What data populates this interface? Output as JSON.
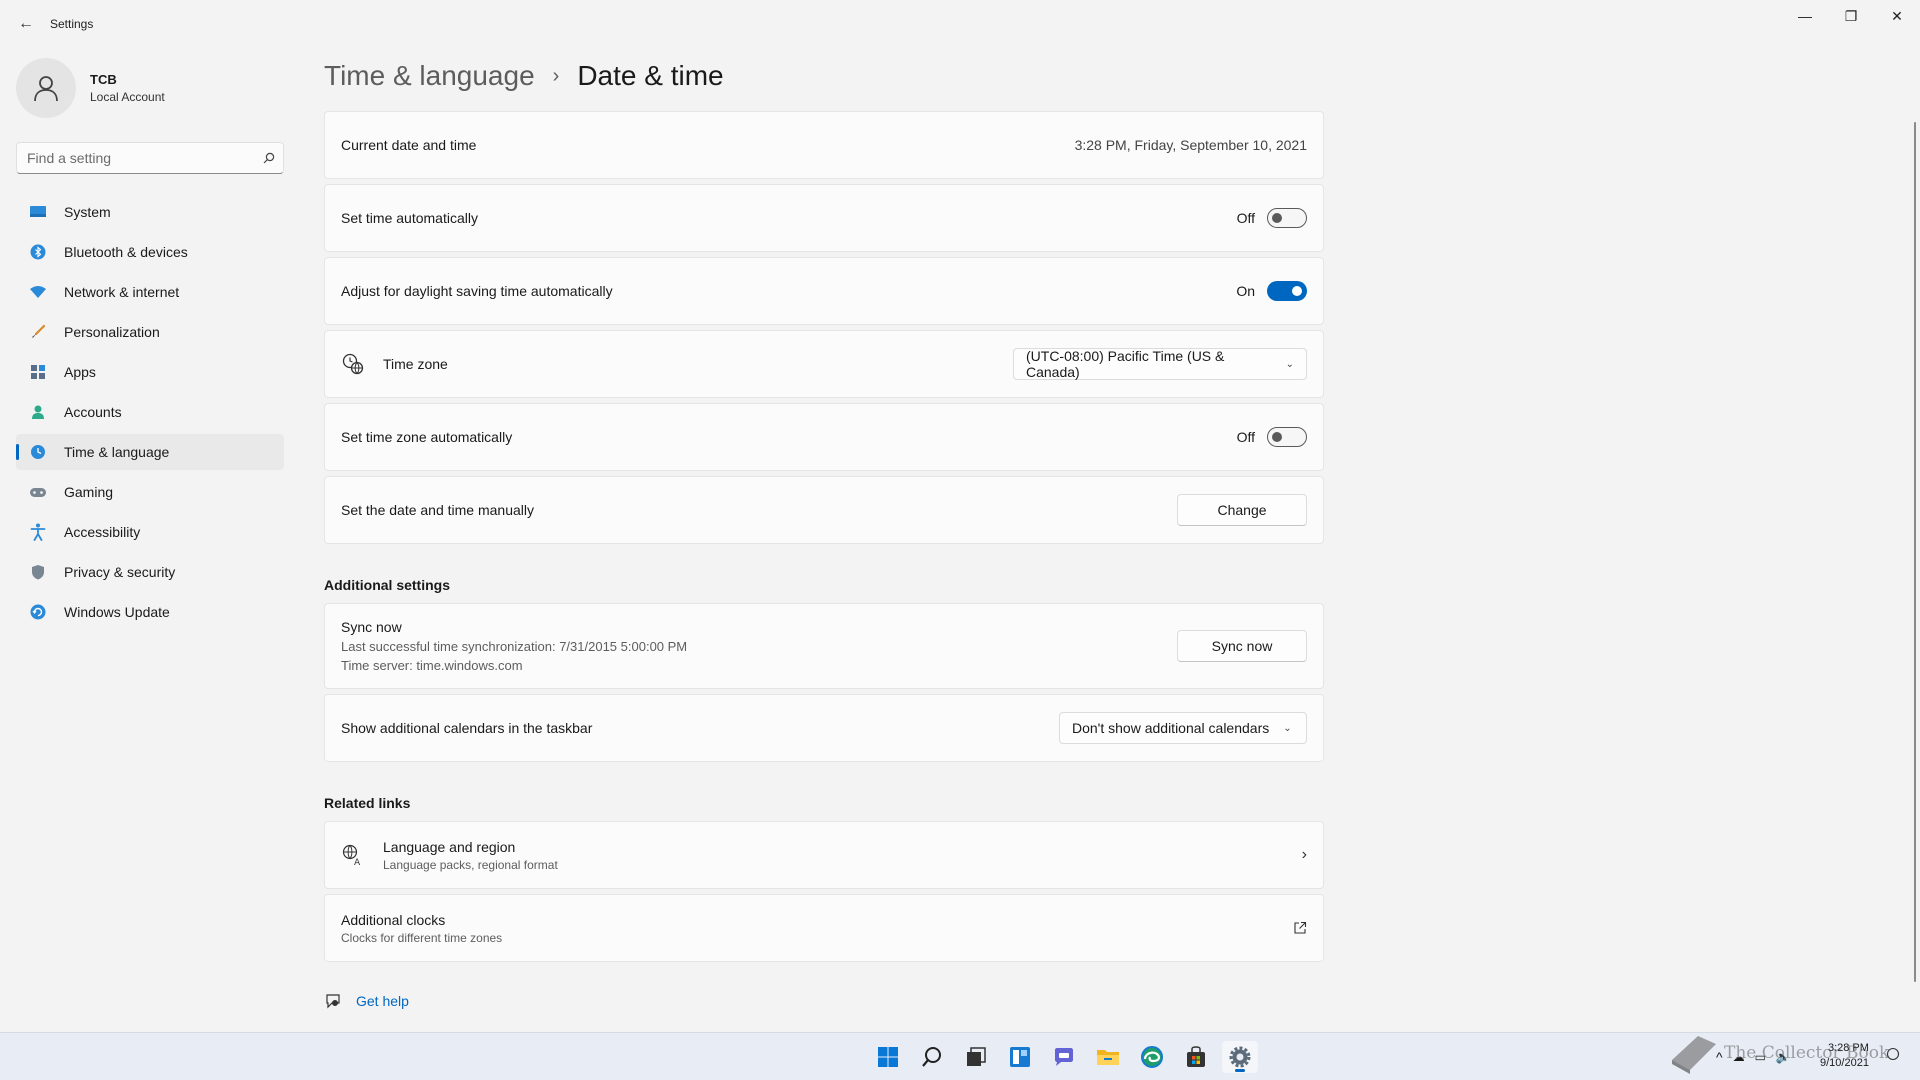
{
  "window": {
    "title": "Settings",
    "minimize_glyph": "—",
    "maximize_glyph": "❐",
    "close_glyph": "✕",
    "back_glyph": "←"
  },
  "profile": {
    "name": "TCB",
    "account_type": "Local Account"
  },
  "search": {
    "placeholder": "Find a setting"
  },
  "sidebar": {
    "items": [
      {
        "label": "System",
        "icon": "monitor-icon"
      },
      {
        "label": "Bluetooth & devices",
        "icon": "bluetooth-icon"
      },
      {
        "label": "Network & internet",
        "icon": "wifi-icon"
      },
      {
        "label": "Personalization",
        "icon": "brush-icon"
      },
      {
        "label": "Apps",
        "icon": "apps-icon"
      },
      {
        "label": "Accounts",
        "icon": "person-icon"
      },
      {
        "label": "Time & language",
        "icon": "globe-clock-icon",
        "selected": true
      },
      {
        "label": "Gaming",
        "icon": "gamepad-icon"
      },
      {
        "label": "Accessibility",
        "icon": "accessibility-icon"
      },
      {
        "label": "Privacy & security",
        "icon": "shield-icon"
      },
      {
        "label": "Windows Update",
        "icon": "update-icon"
      }
    ]
  },
  "breadcrumb": {
    "parent": "Time & language",
    "separator": "›",
    "current": "Date & time"
  },
  "settings": {
    "current_datetime": {
      "label": "Current date and time",
      "value": "3:28 PM, Friday, September 10, 2021"
    },
    "set_time_auto": {
      "label": "Set time automatically",
      "state": "Off"
    },
    "daylight_saving": {
      "label": "Adjust for daylight saving time automatically",
      "state": "On"
    },
    "time_zone": {
      "label": "Time zone",
      "value": "(UTC-08:00) Pacific Time (US & Canada)"
    },
    "set_timezone_auto": {
      "label": "Set time zone automatically",
      "state": "Off"
    },
    "manual": {
      "label": "Set the date and time manually",
      "button": "Change"
    }
  },
  "additional": {
    "title": "Additional settings",
    "sync": {
      "label": "Sync now",
      "last_sync": "Last successful time synchronization: 7/31/2015 5:00:00 PM",
      "server": "Time server: time.windows.com",
      "button": "Sync now"
    },
    "calendars": {
      "label": "Show additional calendars in the taskbar",
      "value": "Don't show additional calendars"
    }
  },
  "related": {
    "title": "Related links",
    "language_region": {
      "label": "Language and region",
      "sub": "Language packs, regional format"
    },
    "additional_clocks": {
      "label": "Additional clocks",
      "sub": "Clocks for different time zones"
    }
  },
  "help": {
    "label": "Get help"
  },
  "taskbar": {
    "icons": [
      "windows-start-icon",
      "search-icon",
      "task-view-icon",
      "widgets-icon",
      "chat-icon",
      "file-explorer-icon",
      "edge-icon",
      "store-icon",
      "settings-icon"
    ],
    "time": "3:28 PM",
    "date": "9/10/2021"
  },
  "watermark": {
    "text": "The Collector Book"
  },
  "colors": {
    "accent": "#0067c0",
    "background": "#f3f3f3",
    "card": "#fbfbfb"
  }
}
